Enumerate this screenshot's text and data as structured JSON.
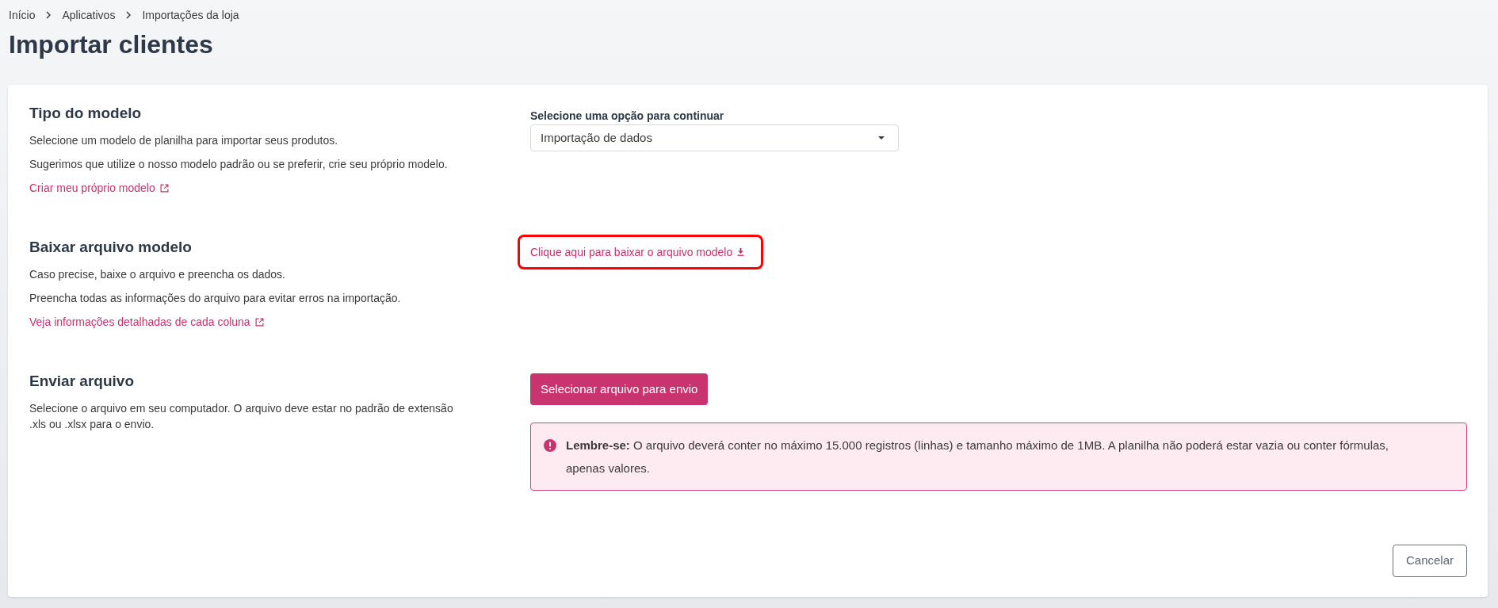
{
  "breadcrumb": [
    {
      "label": "Início"
    },
    {
      "label": "Aplicativos"
    },
    {
      "label": "Importações da loja"
    }
  ],
  "page_title": "Importar clientes",
  "sections": [
    {
      "kind": "select",
      "title": "Tipo do modelo",
      "paragraphs": [
        "Selecione um modelo de planilha para importar seus produtos.",
        "Sugerimos que utilize o nosso modelo padrão ou se preferir, crie seu próprio modelo."
      ],
      "link": "Criar meu próprio modelo",
      "control": {
        "label": "Selecione uma opção para continuar",
        "value": "Importação de dados"
      }
    },
    {
      "kind": "download",
      "title": "Baixar arquivo modelo",
      "paragraphs": [
        "Caso precise, baixe o arquivo e preencha os dados.",
        "Preencha todas as informações do arquivo para evitar erros na importação."
      ],
      "link": "Veja informações detalhadas de cada coluna",
      "control": {
        "link": "Clique aqui para baixar o arquivo modelo",
        "highlighted": true
      }
    },
    {
      "kind": "upload",
      "title": "Enviar arquivo",
      "paragraphs": [
        "Selecione o arquivo em seu computador. O arquivo deve estar no padrão de extensão .xls ou .xlsx para o envio."
      ],
      "control": {
        "button": "Selecionar arquivo para envio",
        "alert": "**Lembre-se:** O arquivo deverá conter no máximo 15.000 registros (linhas) e tamanho máximo de 1MB. A planilha não poderá estar vazia ou conter fórmulas, apenas valores."
      }
    }
  ],
  "footer": {
    "cancel_button": "Cancelar"
  }
}
